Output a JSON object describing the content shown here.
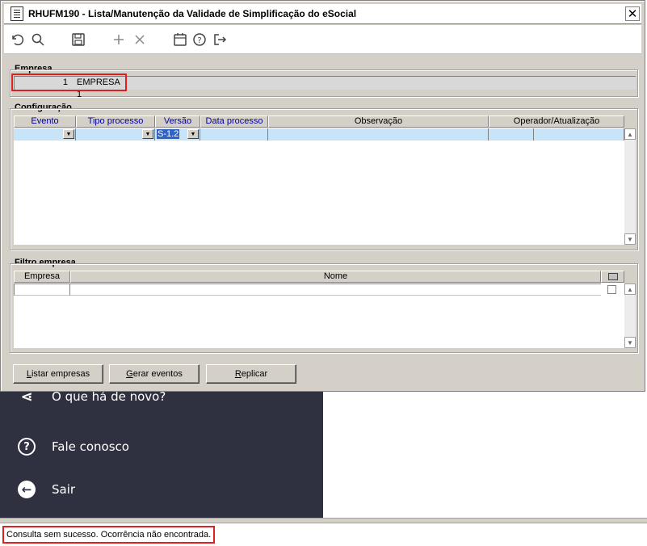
{
  "background": {
    "menu_items": [
      {
        "label": "O que há de novo?",
        "icon": "share-icon"
      },
      {
        "label": "Fale conosco",
        "icon": "question-circle-icon"
      },
      {
        "label": "Sair",
        "icon": "arrow-left-circle-icon"
      }
    ],
    "menu_bg_color": "#2f3040"
  },
  "status": {
    "message": "Consulta sem sucesso. Ocorrência não encontrada.",
    "highlight_color": "#e02020"
  },
  "dialog": {
    "title": "RHUFM190 - Lista/Manutenção da Validade de Simplificação do eSocial",
    "close_label": "✕",
    "toolbar": [
      {
        "name": "undo-icon",
        "glyph": "↺"
      },
      {
        "name": "search-icon",
        "glyph": "⚲"
      },
      {
        "name": "save-icon",
        "glyph": "🖫"
      },
      {
        "name": "add-icon",
        "glyph": "+"
      },
      {
        "name": "delete-icon",
        "glyph": "×"
      },
      {
        "name": "calendar-icon",
        "glyph": "▦"
      },
      {
        "name": "help-icon",
        "glyph": "?"
      },
      {
        "name": "exit-icon",
        "glyph": "⇥"
      }
    ],
    "empresa": {
      "legend": "Empresa",
      "code": "1",
      "name": "EMPRESA 1"
    },
    "configuracao": {
      "legend": "Configuração",
      "columns": [
        "Evento",
        "Tipo processo",
        "Versão",
        "Data processo",
        "Observação",
        "Operador/Atualização"
      ],
      "row": {
        "evento": "",
        "tipo_processo": "",
        "versao": "S-1.2",
        "data_processo": "",
        "observacao": "",
        "operador": "",
        "atualizacao": ""
      }
    },
    "filtro": {
      "legend": "Filtro empresa",
      "columns": [
        "Empresa",
        "Nome"
      ]
    },
    "buttons": {
      "listar_pre": "L",
      "listar_rest": "istar empresas",
      "gerar_pre": "G",
      "gerar_rest": "erar eventos",
      "replicar_pre": "R",
      "replicar_rest": "eplicar"
    }
  }
}
